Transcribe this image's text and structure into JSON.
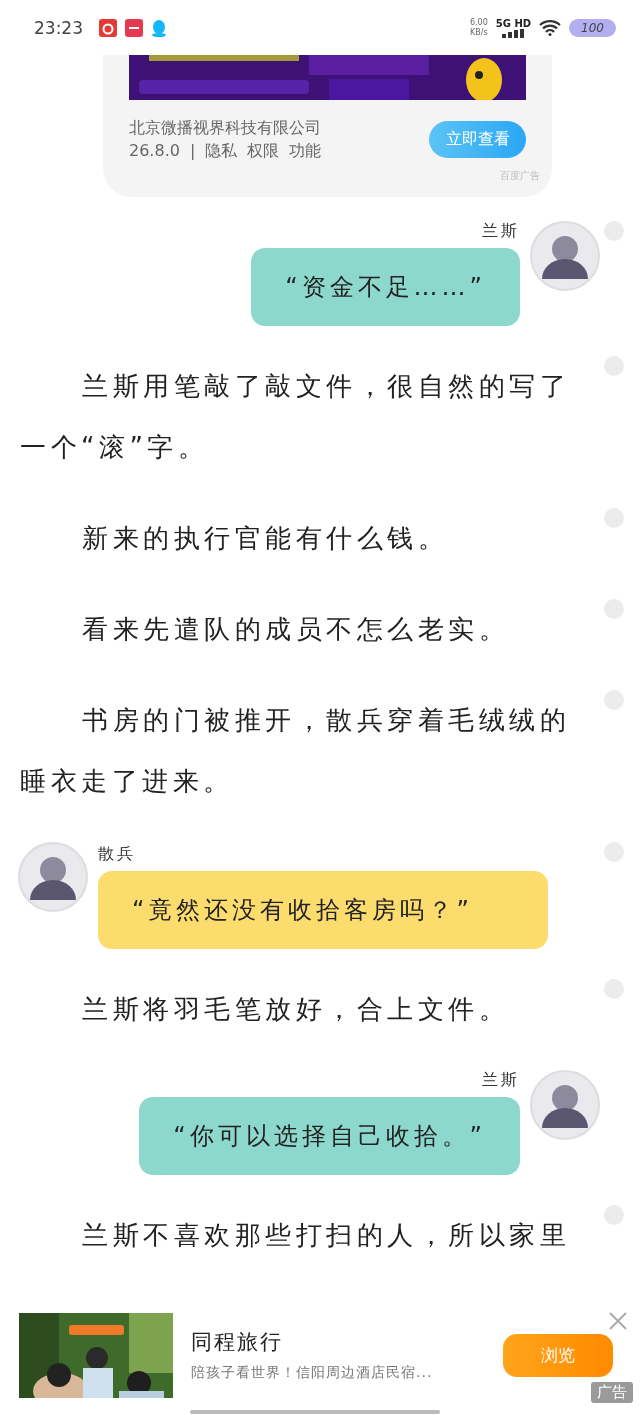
{
  "status_bar": {
    "time": "23:23",
    "net_speed": "6.00",
    "net_unit": "KB/s",
    "network": "5G HD",
    "battery": "100"
  },
  "top_ad": {
    "company": "北京微播视界科技有限公司",
    "version": "26.8.0",
    "separator": "|",
    "links": [
      "隐私",
      "权限",
      "功能"
    ],
    "button": "立即查看",
    "source": "百度广告"
  },
  "content": [
    {
      "kind": "outgoing",
      "speaker": "兰斯",
      "text": "“资金不足……”",
      "color": "#8dd8cc",
      "comment_marker": true
    },
    {
      "kind": "para",
      "text": "兰斯用笔敲了敲文件，很自然的写了一个“滚”字。",
      "comment_marker": true
    },
    {
      "kind": "para",
      "text": "新来的执行官能有什么钱。",
      "comment_marker": true
    },
    {
      "kind": "para",
      "text": "看来先遣队的成员不怎么老实。",
      "comment_marker": true
    },
    {
      "kind": "para",
      "text": "书房的门被推开，散兵穿着毛绒绒的睡衣走了进来。",
      "comment_marker": true
    },
    {
      "kind": "incoming",
      "speaker": "散兵",
      "text": "“竟然还没有收拾客房吗？”",
      "color": "#fddc6e",
      "comment_marker": true
    },
    {
      "kind": "para",
      "text": "兰斯将羽毛笔放好，合上文件。",
      "comment_marker": true
    },
    {
      "kind": "outgoing",
      "speaker": "兰斯",
      "text": "“你可以选择自己收拾。”",
      "color": "#8dd8cc",
      "comment_marker": false
    },
    {
      "kind": "para",
      "text": "兰斯不喜欢那些打扫的人，所以家里",
      "comment_marker": true
    }
  ],
  "bottom_ad": {
    "title": "同程旅行",
    "description": "陪孩子看世界！信阳周边酒店民宿...",
    "button": "浏览",
    "badge": "广告"
  }
}
